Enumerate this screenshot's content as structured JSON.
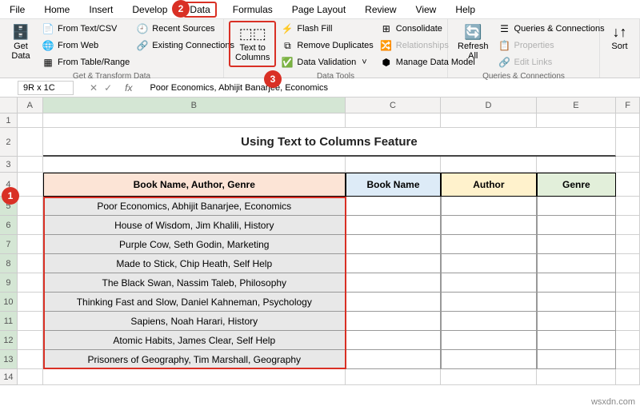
{
  "menu": {
    "file": "File",
    "home": "Home",
    "insert": "Insert",
    "develop": "Develop",
    "data": "Data",
    "formulas": "Formulas",
    "pagelayout": "Page Layout",
    "review": "Review",
    "view": "View",
    "help": "Help"
  },
  "ribbon": {
    "getdata": "Get\nData",
    "from_textcsv": "From Text/CSV",
    "from_web": "From Web",
    "from_table": "From Table/Range",
    "recent_sources": "Recent Sources",
    "existing_conn": "Existing Connections",
    "group1_label": "Get & Transform Data",
    "text_to_columns": "Text to\nColumns",
    "flash_fill": "Flash Fill",
    "remove_dup": "Remove Duplicates",
    "data_validation": "Data Validation",
    "consolidate": "Consolidate",
    "relationships": "Relationships",
    "manage_model": "Manage Data Model",
    "group2_label": "Data Tools",
    "refresh_all": "Refresh\nAll",
    "queries_conn": "Queries & Connections",
    "properties": "Properties",
    "edit_links": "Edit Links",
    "group3_label": "Queries & Connections",
    "sort": "Sort"
  },
  "formula": {
    "namebox": "9R x 1C",
    "value": "Poor Economics, Abhijit Banarjee, Economics"
  },
  "cols": {
    "A": "A",
    "B": "B",
    "C": "C",
    "D": "D",
    "E": "E",
    "F": "F"
  },
  "title": "Using Text to Columns Feature",
  "headers": {
    "b": "Book Name, Author, Genre",
    "c": "Book Name",
    "d": "Author",
    "e": "Genre"
  },
  "rows": [
    "Poor Economics, Abhijit Banarjee, Economics",
    "House of Wisdom, Jim Khalili, History",
    "Purple Cow, Seth Godin, Marketing",
    "Made to Stick, Chip Heath, Self Help",
    "The Black Swan, Nassim Taleb, Philosophy",
    "Thinking Fast and Slow, Daniel Kahneman, Psychology",
    "Sapiens, Noah Harari, History",
    "Atomic Habits, James Clear, Self Help",
    "Prisoners of Geography, Tim Marshall, Geography"
  ],
  "rownums": [
    "1",
    "2",
    "3",
    "4",
    "5",
    "6",
    "7",
    "8",
    "9",
    "10",
    "11",
    "12",
    "13",
    "14"
  ],
  "badges": {
    "b1": "1",
    "b2": "2",
    "b3": "3"
  },
  "watermark": "wsxdn.com"
}
